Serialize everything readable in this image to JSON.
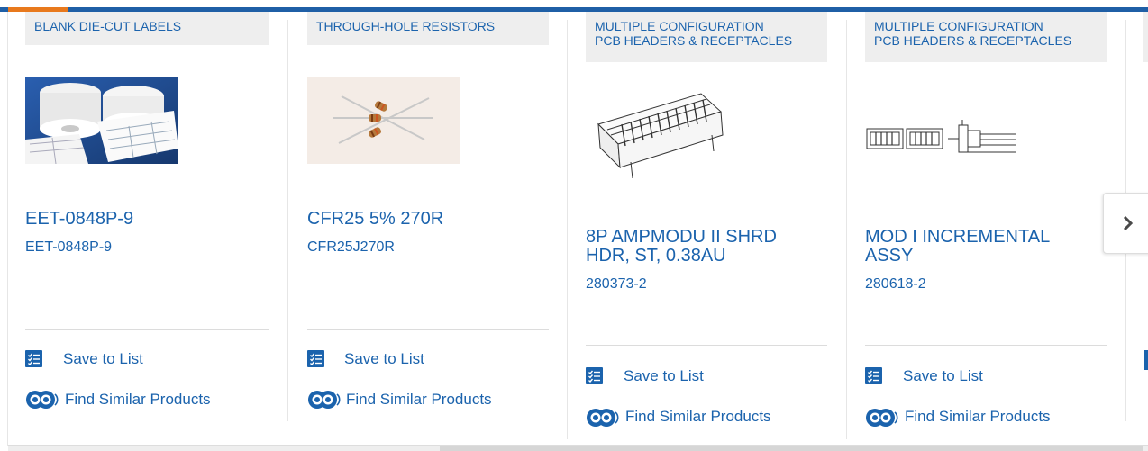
{
  "carousel": {
    "cards": [
      {
        "category": "BLANK DIE-CUT LABELS",
        "title": "EET-0848P-9",
        "part_number": "EET-0848P-9",
        "image": "label-rolls-photo",
        "save_label": "Save to List",
        "similar_label": "Find Similar Products"
      },
      {
        "category": "THROUGH-HOLE RESISTORS",
        "title": "CFR25 5% 270R",
        "part_number": "CFR25J270R",
        "image": "resistors-photo",
        "save_label": "Save to List",
        "similar_label": "Find Similar Products"
      },
      {
        "category_line1": "MULTIPLE CONFIGURATION",
        "category_line2": "PCB HEADERS & RECEPTACLES",
        "title_line1": "8P AMPMODU II SHRD",
        "title_line2": "HDR, ST, 0.38AU",
        "part_number": "280373-2",
        "image": "pcb-header-drawing",
        "save_label": "Save to List",
        "similar_label": "Find Similar Products"
      },
      {
        "category_line1": "MULTIPLE CONFIGURATION",
        "category_line2": "PCB HEADERS & RECEPTACLES",
        "title_line1": "MOD I INCREMENTAL",
        "title_line2": "ASSY",
        "part_number": "280618-2",
        "image": "connector-assembly-drawing",
        "save_label": "Save to List",
        "similar_label": "Find Similar Products"
      }
    ],
    "next_icon": "chevron-right-icon"
  },
  "colors": {
    "link": "#1b63ad",
    "tag_bg": "#eeeeee",
    "top_bar": "#1f5fa6",
    "accent": "#e8791d"
  }
}
